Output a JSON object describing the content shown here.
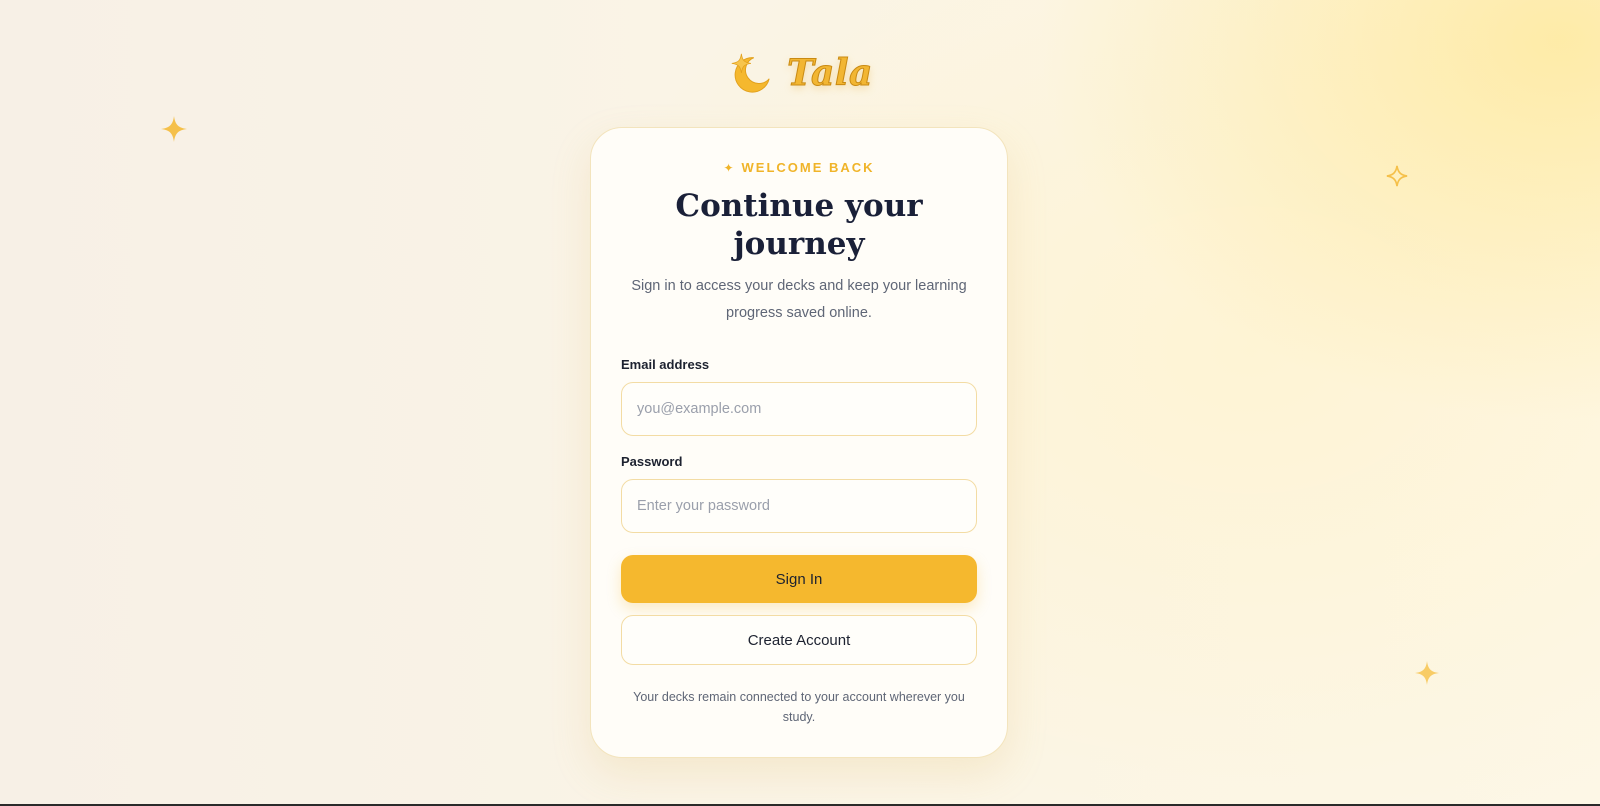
{
  "brand": {
    "name": "Tala",
    "accent": "#f5b82e",
    "logo_icon": "moon-star-icon"
  },
  "card": {
    "eyebrow": "WELCOME BACK",
    "eyebrow_icon": "sparkle-icon",
    "title": "Continue your journey",
    "subtitle": "Sign in to access your decks and keep your learning progress saved online."
  },
  "form": {
    "email_label": "Email address",
    "email_placeholder": "you@example.com",
    "email_value": "",
    "password_label": "Password",
    "password_placeholder": "Enter your password",
    "password_value": "",
    "sign_in_label": "Sign In",
    "create_account_label": "Create Account"
  },
  "footnote": "Your decks remain connected to your account wherever you study.",
  "colors": {
    "text_dark": "#1a2038",
    "text_muted": "#5f6676",
    "border": "#f3dca4"
  }
}
